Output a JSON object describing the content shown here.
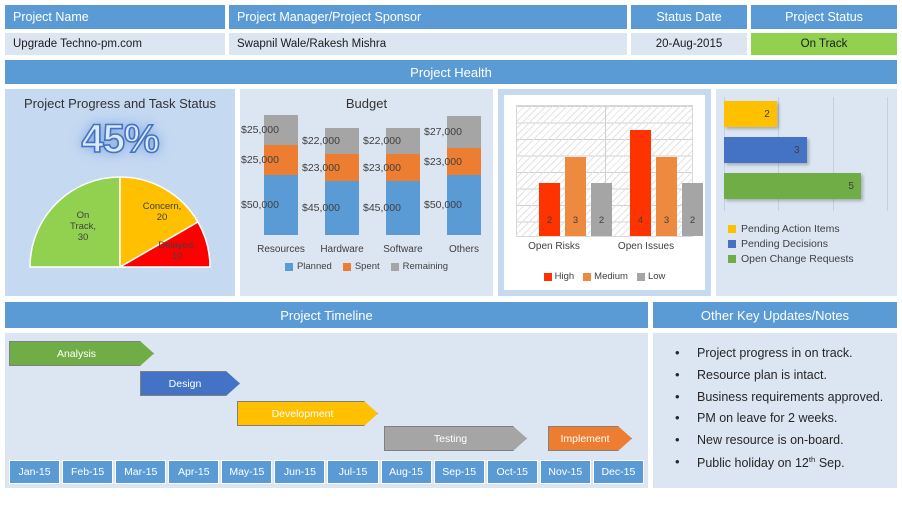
{
  "header": {
    "columns": [
      {
        "label": "Project Name",
        "value": "Upgrade Techno-pm.com"
      },
      {
        "label": "Project Manager/Project Sponsor",
        "value": "Swapnil Wale/Rakesh Mishra"
      },
      {
        "label": "Status Date",
        "value": "20-Aug-2015"
      },
      {
        "label": "Project Status",
        "value": "On Track"
      }
    ],
    "status_color": "#92d050",
    "band_color": "#5b9bd5"
  },
  "health_band": {
    "title": "Project Health"
  },
  "progress": {
    "title": "Project Progress and Task Status",
    "percent_label": "45%",
    "percent_value": 45,
    "chart_data": {
      "type": "pie",
      "title": "Project Progress and Task Status",
      "subtype": "half-doughnut",
      "categories": [
        "On Track",
        "Concern",
        "Delayed"
      ],
      "values": [
        30,
        20,
        10
      ],
      "colors": [
        "#92d050",
        "#ffc000",
        "#ff0000"
      ],
      "labels": [
        "On Track, 30",
        "Concern, 20",
        "Delayed, 10"
      ],
      "total": 60
    },
    "slices": [
      {
        "name": "On Track",
        "value": 30,
        "line1": "On",
        "line2": "Track,",
        "line3": "30",
        "color": "#92d050"
      },
      {
        "name": "Concern",
        "value": 20,
        "line1": "Concern,",
        "line2": "20",
        "line3": "",
        "color": "#ffc000"
      },
      {
        "name": "Delayed",
        "value": 10,
        "line1": "Delayed,",
        "line2": "10",
        "line3": "",
        "color": "#ff0000"
      }
    ]
  },
  "budget": {
    "title": "Budget",
    "chart_data": {
      "type": "bar",
      "subtype": "stacked-column",
      "title": "Budget",
      "xlabel": "",
      "ylabel": "",
      "categories": [
        "Resources",
        "Hardware",
        "Software",
        "Others"
      ],
      "series": [
        {
          "name": "Planned",
          "color": "#5b9bd5",
          "values": [
            50000,
            45000,
            45000,
            50000
          ],
          "labels": [
            "$50,000",
            "$45,000",
            "$45,000",
            "$50,000"
          ]
        },
        {
          "name": "Spent",
          "color": "#ed7d31",
          "values": [
            25000,
            23000,
            23000,
            23000
          ],
          "labels": [
            "$25,000",
            "$23,000",
            "$23,000",
            "$23,000"
          ]
        },
        {
          "name": "Remaining",
          "color": "#a5a5a5",
          "values": [
            25000,
            22000,
            22000,
            27000
          ],
          "labels": [
            "$25,000",
            "$22,000",
            "$22,000",
            "$27,000"
          ]
        }
      ],
      "legend": [
        "Planned",
        "Spent",
        "Remaining"
      ],
      "legend_position": "bottom",
      "grid": true
    },
    "legend": [
      {
        "label": "Planned",
        "color": "#5b9bd5"
      },
      {
        "label": "Spent",
        "color": "#ed7d31"
      },
      {
        "label": "Remaining",
        "color": "#a5a5a5"
      }
    ]
  },
  "risks": {
    "chart_data": {
      "type": "bar",
      "subtype": "clustered-column",
      "title": "",
      "xlabel": "",
      "ylabel": "",
      "categories": [
        "Open Risks",
        "Open Issues"
      ],
      "series": [
        {
          "name": "High",
          "color": "#ff3300",
          "values": [
            2,
            4
          ]
        },
        {
          "name": "Medium",
          "color": "#ed8a3f",
          "values": [
            3,
            3
          ]
        },
        {
          "name": "Low",
          "color": "#a5a5a5",
          "values": [
            2,
            2
          ]
        }
      ],
      "ylim": [
        0,
        5
      ],
      "legend": [
        "High",
        "Medium",
        "Low"
      ],
      "legend_position": "bottom",
      "grid": true
    },
    "categories": [
      "Open Risks",
      "Open Issues"
    ],
    "legend": [
      {
        "label": "High",
        "color": "#ff3300"
      },
      {
        "label": "Medium",
        "color": "#ed8a3f"
      },
      {
        "label": "Low",
        "color": "#a5a5a5"
      }
    ]
  },
  "actions": {
    "chart_data": {
      "type": "bar",
      "subtype": "horizontal-bar",
      "title": "",
      "xlabel": "",
      "ylabel": "",
      "categories": [
        "Pending Action Items",
        "Pending Decisions",
        "Open Change Requests"
      ],
      "values": [
        2,
        3,
        5
      ],
      "colors": [
        "#ffc000",
        "#4472c4",
        "#70ad47"
      ],
      "xlim": [
        0,
        6
      ],
      "legend": [
        "Pending Action Items",
        "Pending Decisions",
        "Open Change Requests"
      ],
      "legend_position": "bottom",
      "grid": true
    },
    "bars": [
      {
        "label": "Pending Action Items",
        "value": "2",
        "color": "#ffc000"
      },
      {
        "label": "Pending Decisions",
        "value": "3",
        "color": "#4472c4"
      },
      {
        "label": "Open Change Requests",
        "value": "5",
        "color": "#70ad47"
      }
    ]
  },
  "timeline": {
    "title": "Project Timeline",
    "phases": [
      {
        "label": "Analysis",
        "color": "#70ad47"
      },
      {
        "label": "Design",
        "color": "#4472c4"
      },
      {
        "label": "Development",
        "color": "#ffc000"
      },
      {
        "label": "Testing",
        "color": "#a5a5a5"
      },
      {
        "label": "Implement",
        "color": "#ed7d31"
      }
    ],
    "months": [
      "Jan-15",
      "Feb-15",
      "Mar-15",
      "Apr-15",
      "May-15",
      "Jun-15",
      "Jul-15",
      "Aug-15",
      "Sep-15",
      "Oct-15",
      "Nov-15",
      "Dec-15"
    ]
  },
  "notes": {
    "title": "Other Key Updates/Notes",
    "items": [
      "Project progress in on track.",
      "Resource plan is intact.",
      "Business requirements approved.",
      "PM on leave for 2 weeks.",
      "New resource is on-board."
    ],
    "last_item_prefix": "Public holiday on 12",
    "last_item_sup": "th",
    "last_item_suffix": " Sep."
  }
}
